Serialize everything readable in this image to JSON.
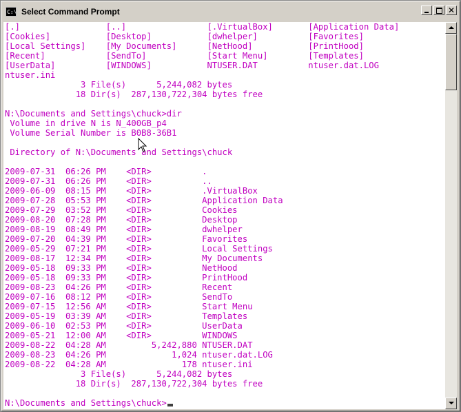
{
  "window": {
    "title": "Select Command Prompt",
    "icon": "cmd-icon",
    "icon_text": "C:\\"
  },
  "console": {
    "lines": [
      "[.]                 [..]                [.VirtualBox]       [Application Data]",
      "[Cookies]           [Desktop]           [dwhelper]          [Favorites]",
      "[Local Settings]    [My Documents]      [NetHood]           [PrintHood]",
      "[Recent]            [SendTo]            [Start Menu]        [Templates]",
      "[UserData]          [WINDOWS]           NTUSER.DAT          ntuser.dat.LOG",
      "ntuser.ini",
      "               3 File(s)      5,244,082 bytes",
      "              18 Dir(s)  287,130,722,304 bytes free",
      "",
      "N:\\Documents and Settings\\chuck>dir",
      " Volume in drive N is N_400GB_p4",
      " Volume Serial Number is B0B8-36B1",
      "",
      " Directory of N:\\Documents and Settings\\chuck",
      "",
      "2009-07-31  06:26 PM    <DIR>          .",
      "2009-07-31  06:26 PM    <DIR>          ..",
      "2009-06-09  08:15 PM    <DIR>          .VirtualBox",
      "2009-07-28  05:53 PM    <DIR>          Application Data",
      "2009-07-29  03:52 PM    <DIR>          Cookies",
      "2009-08-20  07:28 PM    <DIR>          Desktop",
      "2009-08-19  08:49 PM    <DIR>          dwhelper",
      "2009-07-20  04:39 PM    <DIR>          Favorites",
      "2009-05-29  07:21 PM    <DIR>          Local Settings",
      "2009-08-17  12:34 PM    <DIR>          My Documents",
      "2009-05-18  09:33 PM    <DIR>          NetHood",
      "2009-05-18  09:33 PM    <DIR>          PrintHood",
      "2009-08-23  04:26 PM    <DIR>          Recent",
      "2009-07-16  08:12 PM    <DIR>          SendTo",
      "2009-07-15  12:56 AM    <DIR>          Start Menu",
      "2009-05-19  03:39 AM    <DIR>          Templates",
      "2009-06-10  02:53 PM    <DIR>          UserData",
      "2009-05-21  12:00 AM    <DIR>          WINDOWS",
      "2009-08-22  04:28 AM         5,242,880 NTUSER.DAT",
      "2009-08-23  04:26 PM             1,024 ntuser.dat.LOG",
      "2009-08-22  04:28 AM               178 ntuser.ini",
      "               3 File(s)      5,244,082 bytes",
      "              18 Dir(s)  287,130,722,304 bytes free",
      ""
    ],
    "prompt": "N:\\Documents and Settings\\chuck>",
    "text_color": "#c000c0",
    "background_color": "#ffffff"
  },
  "scrollbar": {
    "position_fraction": 0.0
  }
}
